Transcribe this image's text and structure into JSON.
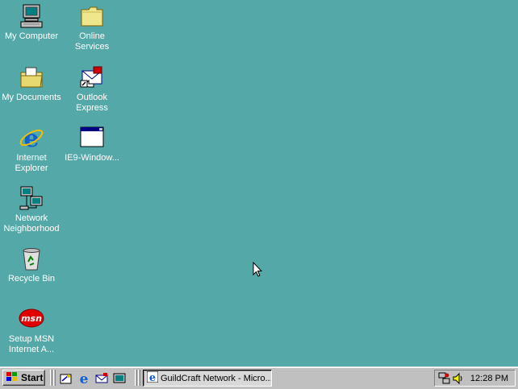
{
  "desktop": {
    "background_color": "#55a8a8",
    "icons": [
      {
        "id": "my-computer",
        "label": "My Computer"
      },
      {
        "id": "online-services",
        "label": "Online\nServices"
      },
      {
        "id": "my-documents",
        "label": "My Documents"
      },
      {
        "id": "outlook-express",
        "label": "Outlook\nExpress"
      },
      {
        "id": "internet-explorer",
        "label": "Internet\nExplorer"
      },
      {
        "id": "ie9-window",
        "label": "IE9-Window..."
      },
      {
        "id": "network-neighborhood",
        "label": "Network\nNeighborhood"
      },
      {
        "id": "recycle-bin",
        "label": "Recycle Bin"
      },
      {
        "id": "setup-msn",
        "label": "Setup MSN\nInternet A..."
      }
    ]
  },
  "taskbar": {
    "start_label": "Start",
    "quick_launch": [
      "show-desktop-icon",
      "internet-explorer-icon",
      "outlook-express-icon",
      "view-channels-icon"
    ],
    "task_button_label": "GuildCraft Network - Micro...",
    "clock": "12:28 PM"
  }
}
